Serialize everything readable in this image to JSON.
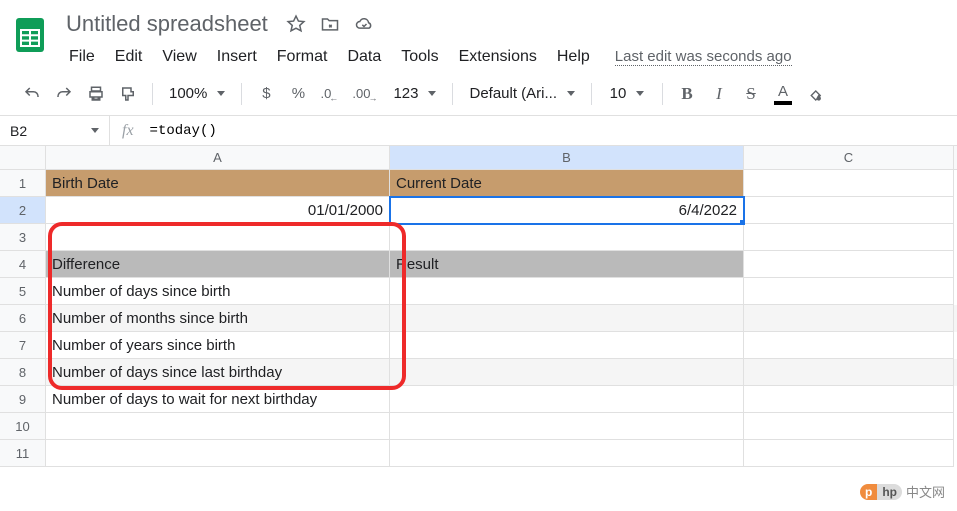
{
  "header": {
    "title": "Untitled spreadsheet",
    "last_edit": "Last edit was seconds ago"
  },
  "menu": [
    "File",
    "Edit",
    "View",
    "Insert",
    "Format",
    "Data",
    "Tools",
    "Extensions",
    "Help"
  ],
  "toolbar": {
    "zoom": "100%",
    "currency": "$",
    "percent": "%",
    "dec_dec": ".0",
    "dec_inc": ".00",
    "more_fmt": "123",
    "font": "Default (Ari...",
    "font_size": "10",
    "bold": "B",
    "italic": "I",
    "strike": "S",
    "text_color": "A"
  },
  "formula_bar": {
    "namebox": "B2",
    "fx": "fx",
    "formula": "=today()"
  },
  "columns": [
    "A",
    "B",
    "C"
  ],
  "rows": [
    {
      "n": "1",
      "A": "Birth Date",
      "B": "Current Date",
      "C": "",
      "styleA": "hdr1",
      "styleB": "hdr1"
    },
    {
      "n": "2",
      "A": "01/01/2000",
      "B": "6/4/2022",
      "C": "",
      "alignA": "right",
      "alignB": "right",
      "activeB": true
    },
    {
      "n": "3",
      "A": "",
      "B": "",
      "C": ""
    },
    {
      "n": "4",
      "A": "Difference",
      "B": "Result",
      "C": "",
      "styleA": "hdr2",
      "styleB": "hdr2"
    },
    {
      "n": "5",
      "A": "Number of days since birth",
      "B": "",
      "C": ""
    },
    {
      "n": "6",
      "A": "Number of months since birth",
      "B": "",
      "C": "",
      "alt": true
    },
    {
      "n": "7",
      "A": "Number of years since birth",
      "B": "",
      "C": ""
    },
    {
      "n": "8",
      "A": "Number of days since last birthday",
      "B": "",
      "C": "",
      "alt": true
    },
    {
      "n": "9",
      "A": "Number of days to wait for next birthday",
      "B": "",
      "C": ""
    },
    {
      "n": "10",
      "A": "",
      "B": "",
      "C": ""
    },
    {
      "n": "11",
      "A": "",
      "B": "",
      "C": ""
    }
  ],
  "watermark": "中文网"
}
